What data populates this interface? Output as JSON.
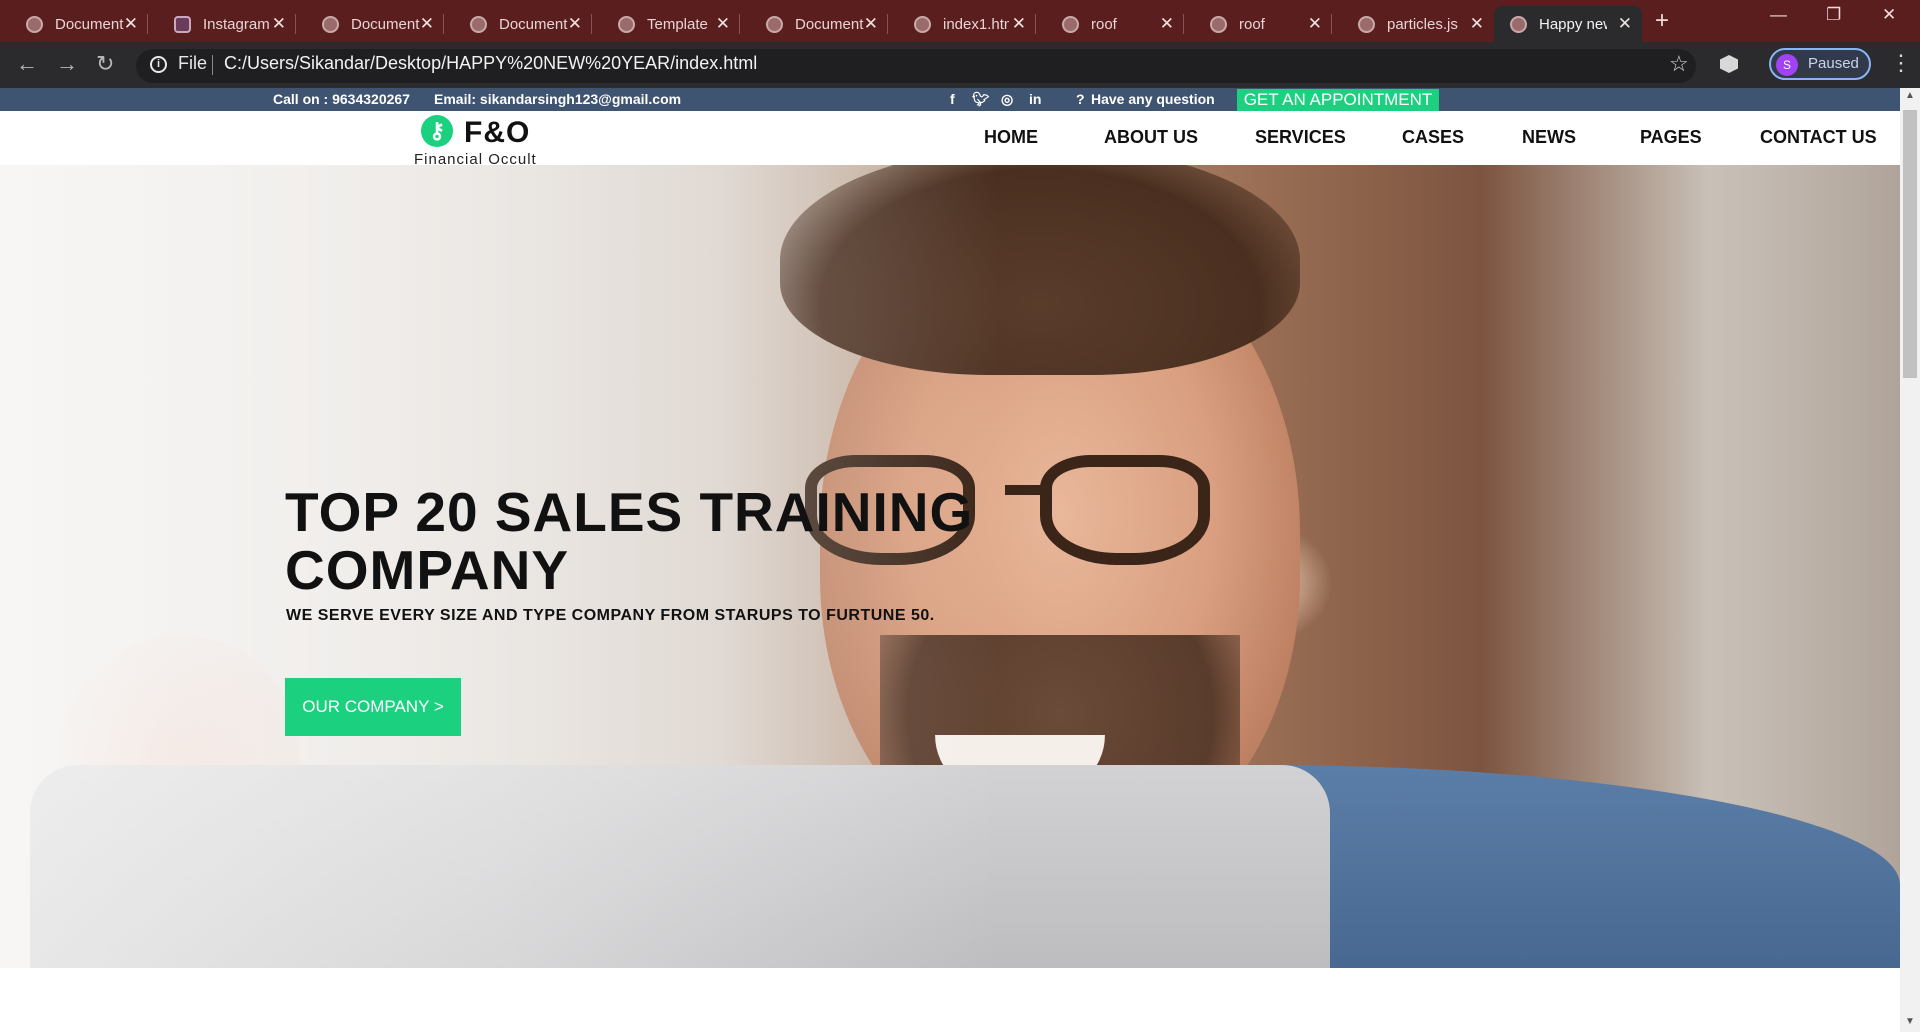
{
  "browser": {
    "tabs": [
      {
        "title": "Document",
        "favicon": "globe-icon"
      },
      {
        "title": "Instagram",
        "favicon": "instagram-icon"
      },
      {
        "title": "Document",
        "favicon": "globe-icon"
      },
      {
        "title": "Document",
        "favicon": "globe-icon"
      },
      {
        "title": "Template",
        "favicon": "globe-icon"
      },
      {
        "title": "Document",
        "favicon": "globe-icon"
      },
      {
        "title": "index1.htm",
        "favicon": "globe-icon"
      },
      {
        "title": "roof",
        "favicon": "globe-icon"
      },
      {
        "title": "roof",
        "favicon": "globe-icon"
      },
      {
        "title": "particles.js",
        "favicon": "globe-icon"
      },
      {
        "title": "Happy new",
        "favicon": "globe-icon",
        "active": true
      }
    ],
    "close_glyph": "✕",
    "newtab_glyph": "+",
    "file_label": "File",
    "url": "C:/Users/Sikandar/Desktop/HAPPY%20NEW%20YEAR/index.html",
    "profile_initial": "S",
    "profile_status": "Paused"
  },
  "site": {
    "topbar": {
      "phone": "Call on : 9634320267",
      "email": "Email: sikandarsingh123@gmail.com",
      "question": "Have any question",
      "appointment": "GET AN APPOINTMENT"
    },
    "logo": {
      "title": "F&O",
      "subtitle": "Financial Occult"
    },
    "nav": [
      "HOME",
      "ABOUT US",
      "SERVICES",
      "CASES",
      "NEWS",
      "PAGES",
      "CONTACT US"
    ],
    "hero": {
      "title": "TOP 20 SALES TRAINING COMPANY",
      "subtitle": "WE SERVE EVERY SIZE AND TYPE COMPANY FROM STARUPS TO FURTUNE 50.",
      "button": "OUR COMPANY >"
    }
  },
  "colors": {
    "accent": "#1bd180",
    "topbar": "#3e5470",
    "tabstrip": "#5a1e1e"
  }
}
